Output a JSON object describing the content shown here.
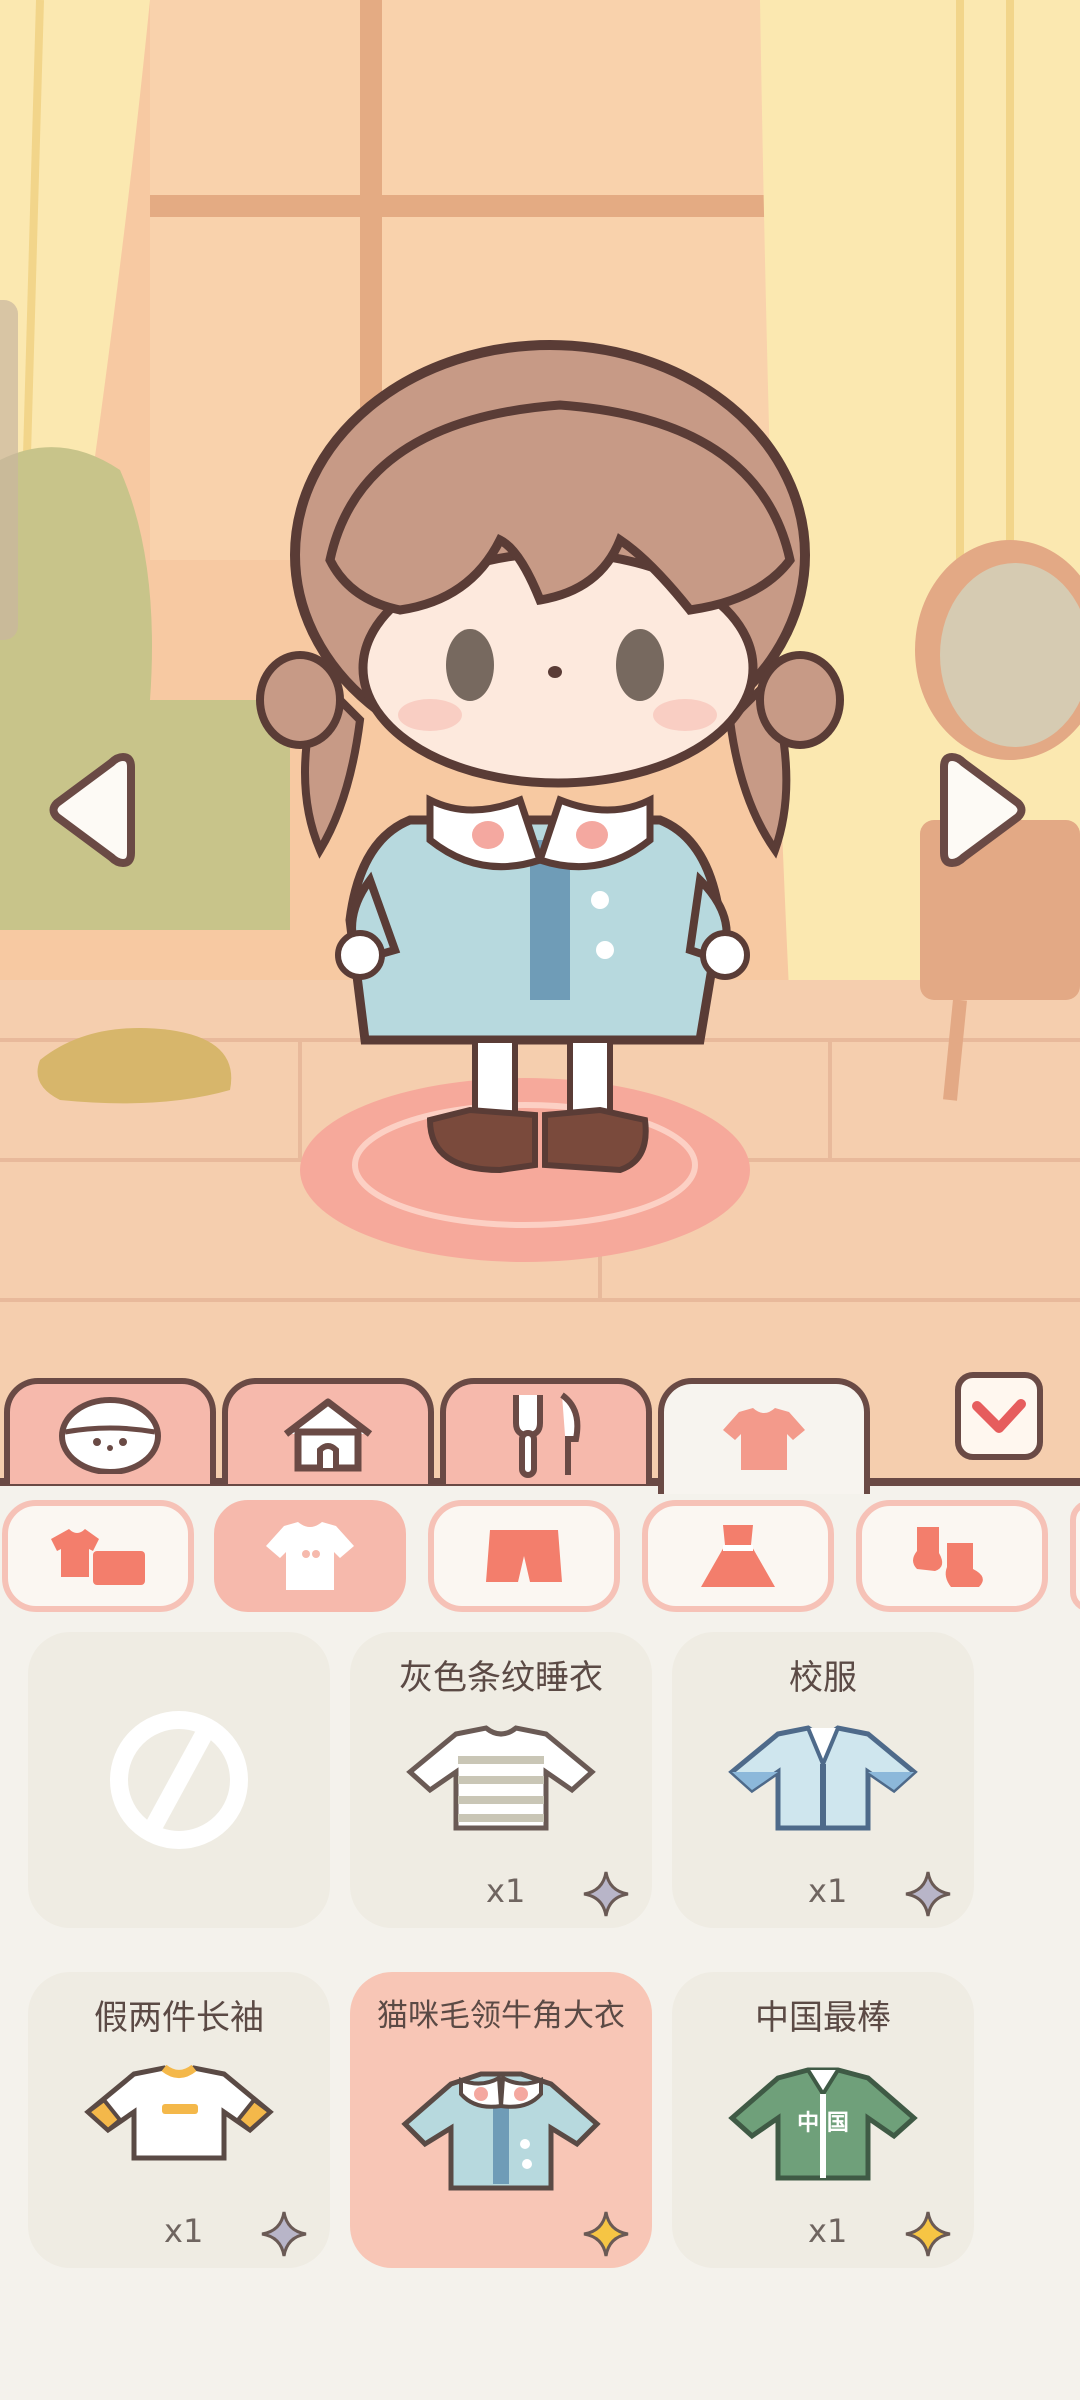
{
  "tabs": [
    {
      "icon": "face-icon",
      "active": false
    },
    {
      "icon": "house-icon",
      "active": false
    },
    {
      "icon": "food-icon",
      "active": false
    },
    {
      "icon": "clothes-icon",
      "active": true
    }
  ],
  "subcategories": [
    {
      "icon": "outfit-set-icon",
      "active": false
    },
    {
      "icon": "top-icon",
      "active": true
    },
    {
      "icon": "pants-icon",
      "active": false
    },
    {
      "icon": "dress-icon",
      "active": false
    },
    {
      "icon": "socks-icon",
      "active": false
    }
  ],
  "items": [
    {
      "name": "",
      "qty": "",
      "icon": "none-icon"
    },
    {
      "name": "灰色条纹睡衣",
      "qty": "x1",
      "icon": "striped-pajama-icon"
    },
    {
      "name": "校服",
      "qty": "x1",
      "icon": "school-uniform-icon"
    },
    {
      "name": "假两件长袖",
      "qty": "x1",
      "icon": "layered-long-sleeve-icon"
    },
    {
      "name": "猫咪毛领牛角大衣",
      "qty": "",
      "icon": "cat-collar-coat-icon",
      "selected": true
    },
    {
      "name": "中国最棒",
      "qty": "x1",
      "icon": "china-jacket-icon"
    }
  ],
  "china_jacket_text": "中 国",
  "colors": {
    "accent": "#f6b9ac",
    "outline": "#6a4a45",
    "star_active": "#f6c544",
    "star_inactive": "#b8b5c8"
  }
}
